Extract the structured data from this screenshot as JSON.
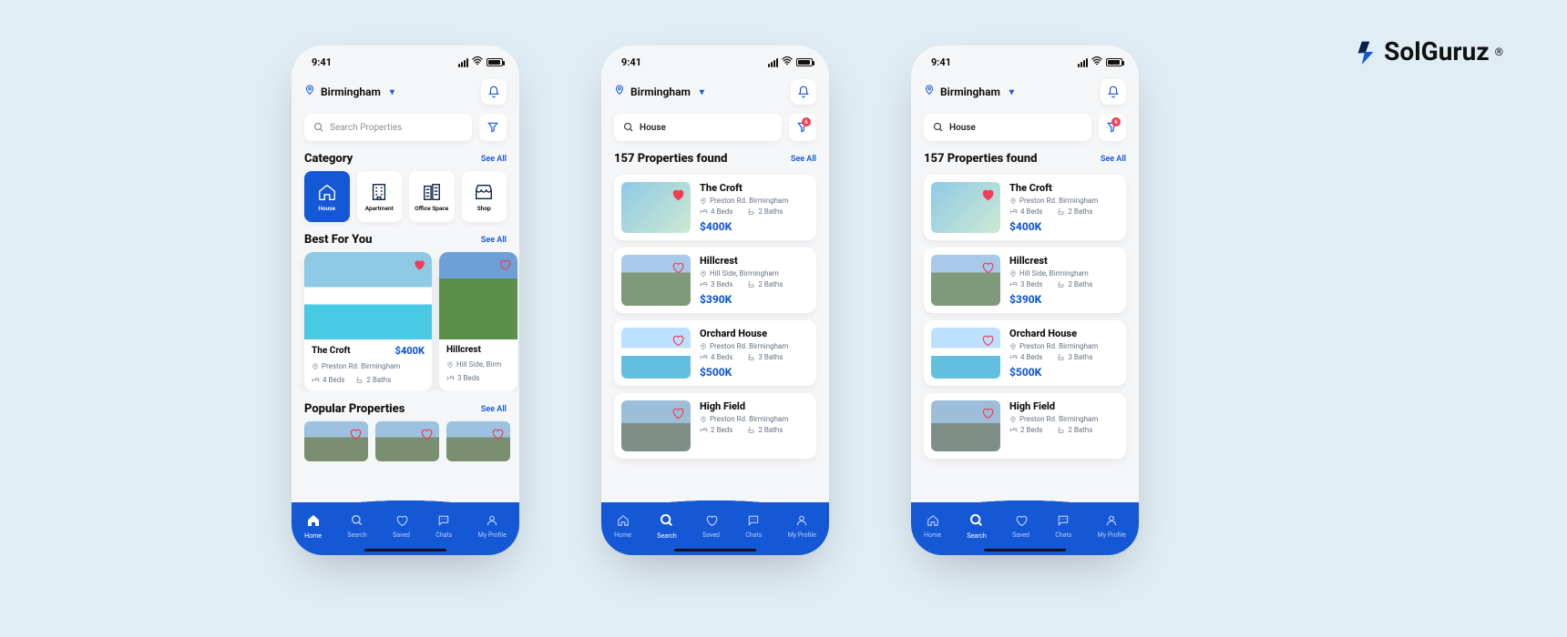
{
  "brand": {
    "name": "SolGuruz",
    "reg": "®"
  },
  "status": {
    "time": "9:41"
  },
  "colors": {
    "accent": "#1558d6",
    "danger": "#f63b54"
  },
  "screen1": {
    "location": "Birmingham",
    "search_placeholder": "Search Properties",
    "category": {
      "title": "Category",
      "see_all": "See All",
      "items": [
        {
          "label": "House",
          "active": true
        },
        {
          "label": "Apartment",
          "active": false
        },
        {
          "label": "Office Space",
          "active": false
        },
        {
          "label": "Shop",
          "active": false
        }
      ]
    },
    "best": {
      "title": "Best For You",
      "see_all": "See All",
      "items": [
        {
          "name": "The Croft",
          "price": "$400K",
          "loc": "Preston Rd. Birmingham",
          "beds": "4 Beds",
          "baths": "2 Baths",
          "fav": true
        },
        {
          "name": "Hillcrest",
          "price": "",
          "loc": "Hill Side, Birm",
          "beds": "3 Beds",
          "baths": "",
          "fav": false
        }
      ]
    },
    "popular": {
      "title": "Popular Properties",
      "see_all": "See All"
    },
    "nav": {
      "active": "Home",
      "items": [
        "Home",
        "Search",
        "Saved",
        "Chats",
        "My Profile"
      ]
    }
  },
  "screen2": {
    "location": "Birmingham",
    "search_value": "House",
    "filter_badge": "6",
    "results_title": "157 Properties found",
    "see_all": "See All",
    "listings": [
      {
        "name": "The Croft",
        "loc": "Preston Rd. Birmingham",
        "beds": "4 Beds",
        "baths": "2 Baths",
        "price": "$400K",
        "fav": true,
        "img": "a"
      },
      {
        "name": "Hillcrest",
        "loc": "Hill Side, Birmingham",
        "beds": "3 Beds",
        "baths": "2 Baths",
        "price": "$390K",
        "fav": false,
        "img": "b"
      },
      {
        "name": "Orchard House",
        "loc": "Preston Rd. Birmingham",
        "beds": "4 Beds",
        "baths": "3 Baths",
        "price": "$500K",
        "fav": false,
        "img": "c"
      },
      {
        "name": "High Field",
        "loc": "Preston Rd. Birmingham",
        "beds": "2 Beds",
        "baths": "2 Baths",
        "price": "",
        "fav": false,
        "img": "d"
      }
    ],
    "nav": {
      "active": "Search",
      "items": [
        "Home",
        "Search",
        "Saved",
        "Chats",
        "My Profile"
      ]
    }
  },
  "screen3": {
    "location": "Birmingham",
    "search_value": "House",
    "filter_badge": "6",
    "results_title": "157 Properties found",
    "see_all": "See All",
    "listings": [
      {
        "name": "The Croft",
        "loc": "Preston Rd. Birmingham",
        "beds": "4 Beds",
        "baths": "2 Baths",
        "price": "$400K",
        "fav": true,
        "img": "a"
      },
      {
        "name": "Hillcrest",
        "loc": "Hill Side, Birmingham",
        "beds": "3 Beds",
        "baths": "2 Baths",
        "price": "$390K",
        "fav": false,
        "img": "b"
      },
      {
        "name": "Orchard House",
        "loc": "Preston Rd. Birmingham",
        "beds": "4 Beds",
        "baths": "3 Baths",
        "price": "$500K",
        "fav": false,
        "img": "c"
      },
      {
        "name": "High Field",
        "loc": "Preston Rd. Birmingham",
        "beds": "2 Beds",
        "baths": "2 Baths",
        "price": "",
        "fav": false,
        "img": "d"
      }
    ],
    "nav": {
      "active": "Search",
      "items": [
        "Home",
        "Search",
        "Saved",
        "Chats",
        "My Profile"
      ]
    }
  }
}
